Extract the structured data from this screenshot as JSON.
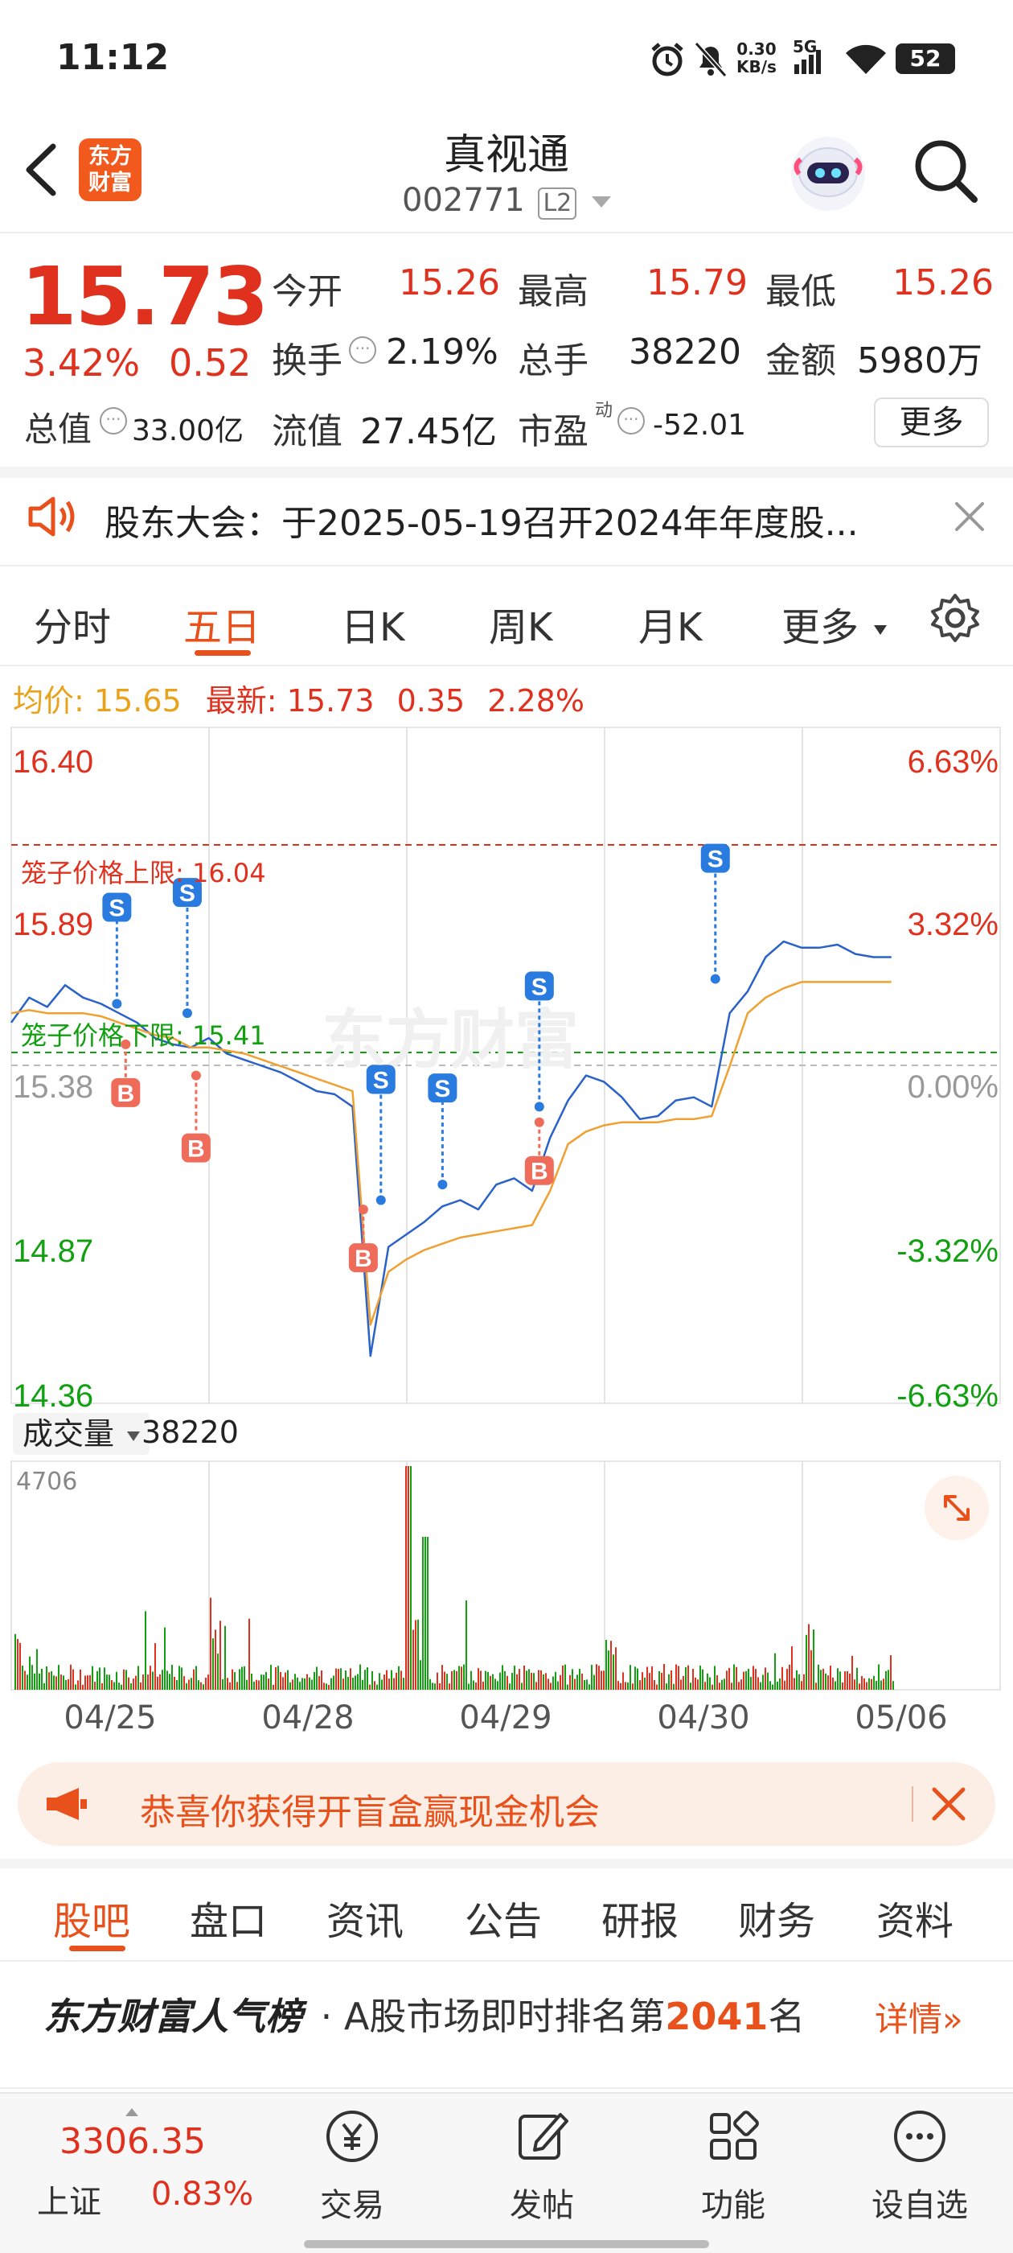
{
  "status_bar": {
    "time": "11:12",
    "net_speed_value": "0.30",
    "net_speed_unit": "KB/s",
    "signal": "5G",
    "battery": "52"
  },
  "header": {
    "logo_line1": "东方",
    "logo_line2": "财富",
    "stock_name": "真视通",
    "stock_code": "002771",
    "level_badge": "L2"
  },
  "quote": {
    "price": "15.73",
    "change_pct": "3.42%",
    "change_abs": "0.52",
    "open_label": "今开",
    "open_value": "15.26",
    "high_label": "最高",
    "high_value": "15.79",
    "low_label": "最低",
    "low_value": "15.26",
    "turnover_label": "换手",
    "turnover_value": "2.19%",
    "volume_label": "总手",
    "volume_value": "38220",
    "amount_label": "金额",
    "amount_value": "5980万",
    "total_cap_label": "总值",
    "total_cap_value": "33.00亿",
    "float_cap_label": "流值",
    "float_cap_value": "27.45亿",
    "pe_label": "市盈",
    "pe_sup": "动",
    "pe_value": "-52.01",
    "more_button": "更多"
  },
  "notice": {
    "text": "股东大会：于2025-05-19召开2024年年度股..."
  },
  "chart_tabs": {
    "items": [
      "分时",
      "五日",
      "日K",
      "周K",
      "月K",
      "更多"
    ],
    "active": "五日"
  },
  "chart_info": {
    "avg_label": "均价:",
    "avg_value": "15.65",
    "latest_label": "最新:",
    "latest_value": "15.73",
    "latest_change": "0.35",
    "latest_pct": "2.28%",
    "cage_upper": "笼子价格上限: 16.04",
    "cage_lower": "笼子价格下限: 15.41",
    "watermark": "东方财富"
  },
  "chart_data": {
    "type": "line",
    "title": "",
    "y_left_ticks": [
      "16.40",
      "15.89",
      "15.38",
      "14.87",
      "14.36"
    ],
    "y_right_ticks": [
      "6.63%",
      "3.32%",
      "0.00%",
      "-3.32%",
      "-6.63%"
    ],
    "ylim": [
      14.36,
      16.4
    ],
    "x_labels": [
      "04/25",
      "04/28",
      "04/29",
      "04/30",
      "05/06"
    ],
    "days": 5,
    "points_per_day": 10,
    "series": [
      {
        "name": "最新",
        "color": "#2a62c9",
        "values": [
          15.52,
          15.6,
          15.57,
          15.64,
          15.6,
          15.58,
          15.55,
          15.52,
          15.47,
          15.45,
          15.44,
          15.47,
          15.42,
          15.4,
          15.38,
          15.36,
          15.33,
          15.3,
          15.29,
          15.25,
          14.45,
          14.8,
          14.84,
          14.88,
          14.93,
          14.95,
          14.92,
          15.0,
          15.02,
          14.98,
          15.15,
          15.27,
          15.35,
          15.33,
          15.28,
          15.21,
          15.22,
          15.27,
          15.28,
          15.25,
          15.55,
          15.62,
          15.73,
          15.78,
          15.76,
          15.76,
          15.77,
          15.74,
          15.73,
          15.73
        ]
      },
      {
        "name": "均价",
        "color": "#f0a030",
        "values": [
          15.55,
          15.56,
          15.55,
          15.55,
          15.55,
          15.54,
          15.52,
          15.5,
          15.48,
          15.47,
          15.44,
          15.44,
          15.43,
          15.42,
          15.4,
          15.38,
          15.36,
          15.34,
          15.32,
          15.3,
          14.55,
          14.72,
          14.76,
          14.79,
          14.81,
          14.83,
          14.84,
          14.85,
          14.86,
          14.87,
          14.98,
          15.13,
          15.17,
          15.19,
          15.2,
          15.2,
          15.2,
          15.21,
          15.21,
          15.22,
          15.38,
          15.55,
          15.6,
          15.63,
          15.65,
          15.65,
          15.65,
          15.65,
          15.65,
          15.65
        ]
      }
    ],
    "trade_marks": [
      {
        "type": "S",
        "day": 0.6,
        "price": 15.58
      },
      {
        "type": "S",
        "day": 1.0,
        "price": 15.55
      },
      {
        "type": "B",
        "day": 0.65,
        "price": 15.45
      },
      {
        "type": "B",
        "day": 1.05,
        "price": 15.35
      },
      {
        "type": "B",
        "day": 2.0,
        "price": 14.92
      },
      {
        "type": "S",
        "day": 2.1,
        "price": 14.95
      },
      {
        "type": "S",
        "day": 2.45,
        "price": 15.0
      },
      {
        "type": "S",
        "day": 3.0,
        "price": 15.25
      },
      {
        "type": "B",
        "day": 3.0,
        "price": 15.2
      },
      {
        "type": "S",
        "day": 4.0,
        "price": 15.66
      }
    ]
  },
  "volume": {
    "label": "成交量",
    "total": "38220",
    "max_label": "4706"
  },
  "banner": {
    "text": "恭喜你获得开盲盒赢现金机会"
  },
  "section_tabs": {
    "items": [
      "股吧",
      "盘口",
      "资讯",
      "公告",
      "研报",
      "财务",
      "资料"
    ],
    "active": "股吧"
  },
  "rank": {
    "brand": "东方财富人气榜",
    "text_prefix": "· A股市场即时排名第",
    "rank_value": "2041",
    "text_suffix": "名",
    "detail": "详情"
  },
  "bottom_nav": {
    "index_value": "3306.35",
    "index_name": "上证",
    "index_pct": "0.83%",
    "items": [
      "交易",
      "发帖",
      "功能",
      "设自选"
    ]
  }
}
